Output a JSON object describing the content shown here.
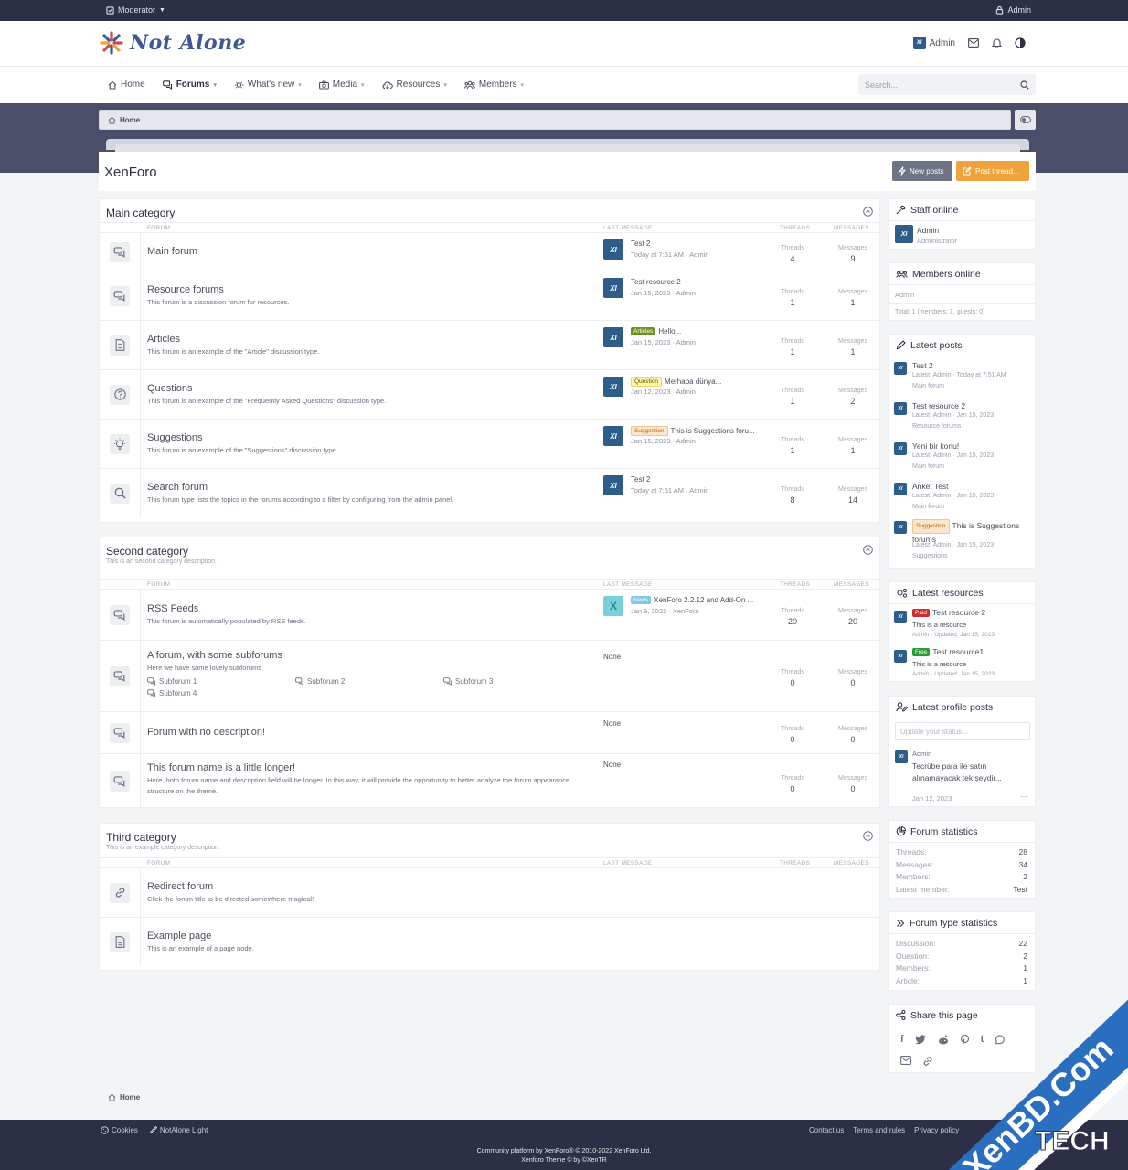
{
  "topbar": {
    "moderator": "Moderator",
    "admin": "Admin"
  },
  "header": {
    "logo": "Not Alone",
    "user": "Admin",
    "avatar_text": "XI"
  },
  "nav": {
    "items": [
      {
        "label": "Home"
      },
      {
        "label": "Forums"
      },
      {
        "label": "What's new"
      },
      {
        "label": "Media"
      },
      {
        "label": "Resources"
      },
      {
        "label": "Members"
      }
    ],
    "search_placeholder": "Search..."
  },
  "breadcrumb": {
    "home": "Home"
  },
  "page": {
    "title": "XenForo",
    "new_posts": "New posts",
    "post_thread": "Post thread..."
  },
  "columns": {
    "forum": "FORUM",
    "last": "LAST MESSAGE",
    "threads": "THREADS",
    "messages": "MESSAGES"
  },
  "stat_labels": {
    "threads": "Threads",
    "messages": "Messages"
  },
  "categories": [
    {
      "title": "Main category",
      "description": "",
      "forums": [
        {
          "name": "Main forum",
          "description": "",
          "icon": "chat-icon",
          "last_title": "Test 2",
          "last_label": "",
          "last_meta": "Today at 7:51 AM · Admin",
          "threads": "4",
          "messages": "9"
        },
        {
          "name": "Resource forums",
          "description": "This forum is a discussion forum for resources.",
          "icon": "chat-icon",
          "last_title": "Test resource 2",
          "last_label": "",
          "last_meta": "Jan 15, 2023 · Admin",
          "threads": "1",
          "messages": "1"
        },
        {
          "name": "Articles",
          "description": "This forum is an example of the \"Article\" discussion type.",
          "icon": "article-icon",
          "last_title": "Hello...",
          "last_label": "Articles",
          "last_meta": "Jan 15, 2023 · Admin",
          "threads": "1",
          "messages": "1"
        },
        {
          "name": "Questions",
          "description": "This forum is an example of the \"Frequently Asked Questions\" discussion type.",
          "icon": "question-icon",
          "last_title": "Merhaba dünya...",
          "last_label": "Question",
          "last_meta": "Jan 12, 2023 · Admin",
          "threads": "1",
          "messages": "2"
        },
        {
          "name": "Suggestions",
          "description": "This forum is an example of the \"Suggestions\" discussion type.",
          "icon": "lightbulb-icon",
          "last_title": "This is Suggestions foru...",
          "last_label": "Suggestion",
          "last_meta": "Jan 15, 2023 · Admin",
          "threads": "1",
          "messages": "1"
        },
        {
          "name": "Search forum",
          "description": "This forum type lists the topics in the forums according to a filter by configuring from the admin panel.",
          "icon": "search-icon",
          "last_title": "Test 2",
          "last_label": "",
          "last_meta": "Today at 7:51 AM · Admin",
          "threads": "8",
          "messages": "14"
        }
      ]
    },
    {
      "title": "Second category",
      "description": "This is an second category description.",
      "forums": [
        {
          "name": "RSS Feeds",
          "description": "This forum is automatically populated by RSS feeds.",
          "icon": "chat-icon",
          "last_title": "XenForo 2.2.12 and Add-On ...",
          "last_label": "News",
          "last_meta": "Jan 9, 2023 · XenForo",
          "threads": "20",
          "messages": "20"
        },
        {
          "name": "A forum, with some subforums",
          "description": "Here we have some lovely subforums",
          "icon": "chat-icon",
          "last_title": "None",
          "last_label": "",
          "last_meta": "",
          "threads": "0",
          "messages": "0",
          "subforums": [
            "Subforum 1",
            "Subforum 2",
            "Subforum 3",
            "Subforum 4"
          ]
        },
        {
          "name": "Forum with no description!",
          "description": "",
          "icon": "chat-icon",
          "last_title": "None",
          "last_label": "",
          "last_meta": "",
          "threads": "0",
          "messages": "0"
        },
        {
          "name": "This forum name is a little longer!",
          "description": "Here, both forum name and description field will be longer. In this way, it will provide the opportunity to better analyze the forum appearance structure on the theme.",
          "icon": "chat-icon",
          "last_title": "None",
          "last_label": "",
          "last_meta": "",
          "threads": "0",
          "messages": "0"
        }
      ]
    },
    {
      "title": "Third category",
      "description": "This is an example category description.",
      "forums": [
        {
          "name": "Redirect forum",
          "description": "Click the forum title to be directed somewhere magical!",
          "icon": "link-icon"
        },
        {
          "name": "Example page",
          "description": "This is an example of a page node.",
          "icon": "page-icon"
        }
      ]
    }
  ],
  "sidebar": {
    "staff": {
      "title": "Staff online",
      "name": "Admin",
      "role": "Administrator"
    },
    "members": {
      "title": "Members online",
      "list": "Admin",
      "total": "Total: 1 (members: 1, guests: 0)"
    },
    "latest_posts": {
      "title": "Latest posts",
      "items": [
        {
          "title": "Test 2",
          "label": "",
          "meta": "Latest: Admin · Today at 7:51 AM",
          "forum": "Main forum"
        },
        {
          "title": "Test resource 2",
          "label": "",
          "meta": "Latest: Admin · Jan 15, 2023",
          "forum": "Resource forums"
        },
        {
          "title": "Yeni bir konu!",
          "label": "",
          "meta": "Latest: Admin · Jan 15, 2023",
          "forum": "Main forum"
        },
        {
          "title": "Anket Test",
          "label": "",
          "meta": "Latest: Admin · Jan 15, 2023",
          "forum": "Main forum"
        },
        {
          "title": "This is Suggestions forums",
          "label": "Suggestion",
          "meta": "Latest: Admin · Jan 15, 2023",
          "forum": "Suggestions"
        }
      ]
    },
    "latest_resources": {
      "title": "Latest resources",
      "items": [
        {
          "label": "Paid",
          "title": "Test resource 2",
          "desc": "This is a resource",
          "meta": "Admin · Updated: Jan 15, 2023"
        },
        {
          "label": "Free",
          "title": "Test resource1",
          "desc": "This is a resource",
          "meta": "Admin · Updated: Jan 15, 2023"
        }
      ]
    },
    "profile_posts": {
      "title": "Latest profile posts",
      "placeholder": "Update your status...",
      "user": "Admin",
      "text": "Tecrübe para ile satın alınamayacak tek şeydir...",
      "date": "Jan 12, 2023",
      "more": "···"
    },
    "forum_stats": {
      "title": "Forum statistics",
      "rows": [
        {
          "k": "Threads:",
          "v": "28"
        },
        {
          "k": "Messages:",
          "v": "34"
        },
        {
          "k": "Members:",
          "v": "2"
        },
        {
          "k": "Latest member:",
          "v": "Test"
        }
      ]
    },
    "type_stats": {
      "title": "Forum type statistics",
      "rows": [
        {
          "k": "Discussion:",
          "v": "22"
        },
        {
          "k": "Question:",
          "v": "2"
        },
        {
          "k": "Members:",
          "v": "1"
        },
        {
          "k": "Article:",
          "v": "1"
        }
      ]
    },
    "share": {
      "title": "Share this page"
    }
  },
  "footer": {
    "cookies": "Cookies",
    "style": "NotAlone Light",
    "contact": "Contact us",
    "terms": "Terms and rules",
    "privacy": "Privacy policy",
    "copyright": "Community platform by XenForo® © 2010-2022 XenForo Ltd.",
    "theme": "Xenforo Theme © by ©XenTR"
  },
  "watermark": {
    "text": "XenBD.Com",
    "sub": "TECH"
  },
  "colors": {
    "nav_dark": "#2c2f45",
    "band": "#4b4e69",
    "accent": "#f0a33c",
    "avatar": "#2f5d8a"
  }
}
